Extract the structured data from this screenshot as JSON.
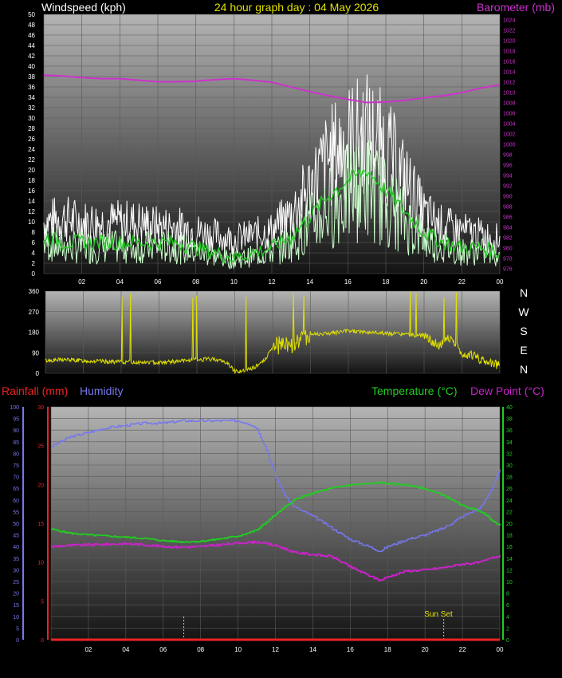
{
  "header": {
    "wind_label": "Windspeed (kph)",
    "title": "24 hour graph day : 04 May 2026",
    "baro_label": "Barometer (mb)"
  },
  "bottom_header": {
    "rain_label": "Rainfall (mm)",
    "humidity_label": "Humidity",
    "temp_label": "Temperature (°C)",
    "dew_label": "Dew Point (°C)"
  },
  "compass": [
    "N",
    "W",
    "S",
    "E",
    "N"
  ],
  "sunset_label": "Sun Set",
  "colors": {
    "wind_gust": "#ffffff",
    "wind_avg": "#22cc22",
    "wind_light": "#ccffcc",
    "barometer": "#cc33cc",
    "direction": "#e0e000",
    "humidity": "#7777ee",
    "temperature": "#22cc22",
    "dewpoint": "#cc22cc",
    "rainfall": "#ee2222",
    "marker": "#e0e000"
  },
  "chart_data": [
    {
      "type": "line",
      "title": "24 hour graph day : 04 May 2026",
      "x_ticks": [
        "02",
        "04",
        "06",
        "08",
        "10",
        "12",
        "14",
        "16",
        "18",
        "20",
        "22",
        "00"
      ],
      "x_hours": [
        0,
        2,
        4,
        6,
        8,
        10,
        12,
        14,
        16,
        18,
        20,
        22,
        24
      ],
      "ylabel_left": "Windspeed (kph)",
      "ylim_left": [
        0,
        50
      ],
      "y_ticks_left": [
        0,
        2,
        4,
        6,
        8,
        10,
        12,
        14,
        16,
        18,
        20,
        22,
        24,
        26,
        28,
        30,
        32,
        34,
        36,
        38,
        40,
        42,
        44,
        46,
        48,
        50
      ],
      "ylabel_right": "Barometer (mb)",
      "ylim_right": [
        975,
        1025
      ],
      "y_ticks_right": [
        976,
        978,
        980,
        982,
        984,
        986,
        988,
        990,
        992,
        994,
        996,
        998,
        1000,
        1002,
        1004,
        1006,
        1008,
        1010,
        1012,
        1014,
        1016,
        1018,
        1020,
        1022,
        1024
      ],
      "series": [
        {
          "name": "Windspeed (kph)",
          "key": "gust_envelope",
          "hours": [
            0,
            1,
            2,
            3,
            4,
            5,
            6,
            7,
            8,
            9,
            10,
            11,
            12,
            13,
            14,
            15,
            16,
            17,
            18,
            19,
            20,
            21,
            22,
            23,
            24
          ],
          "values": [
            12,
            13,
            12,
            12,
            12,
            12,
            11,
            11,
            10,
            9,
            8,
            9,
            10,
            14,
            20,
            27,
            31,
            33,
            29,
            22,
            14,
            11,
            10,
            9,
            8
          ]
        },
        {
          "name": "Windspeed avg",
          "key": "avg_envelope",
          "hours": [
            0,
            1,
            2,
            3,
            4,
            5,
            6,
            7,
            8,
            9,
            10,
            11,
            12,
            13,
            14,
            15,
            16,
            17,
            18,
            19,
            20,
            21,
            22,
            23,
            24
          ],
          "values": [
            7,
            6,
            6,
            6,
            6,
            6,
            6,
            6,
            5,
            4,
            3,
            4,
            5,
            7,
            11,
            15,
            18,
            20,
            16,
            12,
            8,
            6,
            5,
            5,
            4
          ]
        },
        {
          "name": "Barometer (mb)",
          "key": "barometer",
          "hours": [
            0,
            1,
            2,
            3,
            4,
            5,
            6,
            7,
            8,
            9,
            10,
            11,
            12,
            13,
            14,
            15,
            16,
            17,
            18,
            19,
            20,
            21,
            22,
            23,
            24
          ],
          "values": [
            1013.3,
            1013.1,
            1012.8,
            1012.6,
            1012.6,
            1012.3,
            1012.0,
            1012.0,
            1012.1,
            1012.4,
            1012.6,
            1012.3,
            1011.9,
            1011.0,
            1010.1,
            1009.3,
            1008.6,
            1008.0,
            1008.1,
            1008.4,
            1008.9,
            1009.3,
            1009.9,
            1010.8,
            1011.4
          ]
        }
      ]
    },
    {
      "type": "line",
      "title": "",
      "ylim": [
        0,
        360
      ],
      "y_ticks": [
        0,
        90,
        180,
        270,
        360
      ],
      "compass_labels": [
        "N",
        "W",
        "S",
        "E",
        "N"
      ],
      "series": [
        {
          "name": "Wind direction",
          "key": "direction",
          "hours": [
            0,
            1,
            2,
            3,
            4,
            5,
            6,
            7,
            8,
            9,
            9.6,
            10,
            10.5,
            11,
            11.5,
            12,
            12.5,
            13,
            13.5,
            14,
            15,
            16,
            17,
            18,
            19,
            20,
            20.8,
            21.2,
            21.6,
            22,
            22.5,
            23,
            23.5,
            24
          ],
          "values": [
            55,
            60,
            55,
            52,
            50,
            48,
            48,
            52,
            60,
            62,
            45,
            10,
            10,
            25,
            50,
            110,
            130,
            120,
            150,
            170,
            175,
            185,
            180,
            175,
            170,
            165,
            120,
            160,
            140,
            80,
            80,
            60,
            50,
            30
          ]
        }
      ]
    },
    {
      "type": "line",
      "title": "",
      "ylabel_left": "Rainfall (mm)",
      "ylim_rain": [
        0,
        30
      ],
      "y_ticks_rain": [
        0,
        5,
        10,
        15,
        20,
        25,
        30
      ],
      "ylabel_left_outer": "Humidity",
      "ylim_humidity": [
        0,
        100
      ],
      "y_ticks_humidity": [
        0,
        5,
        10,
        15,
        20,
        25,
        30,
        35,
        40,
        45,
        50,
        55,
        60,
        65,
        70,
        75,
        80,
        85,
        90,
        95,
        100
      ],
      "ylabel_right": "Temperature (°C) / Dew Point (°C)",
      "ylim_temp": [
        0,
        40
      ],
      "y_ticks_temp": [
        0,
        2,
        4,
        6,
        8,
        10,
        12,
        14,
        16,
        18,
        20,
        22,
        24,
        26,
        28,
        30,
        32,
        34,
        36,
        38,
        40
      ],
      "sunset_hour": 21.0,
      "sunrise_hour": 7.1,
      "series": [
        {
          "name": "Humidity",
          "key": "humidity",
          "hours": [
            0,
            1,
            2,
            3,
            4,
            5,
            6,
            7,
            8,
            9,
            10,
            10.5,
            11,
            11.5,
            12,
            12.5,
            13,
            14,
            15,
            16,
            17,
            17.6,
            18,
            19,
            20,
            21,
            22,
            23,
            23.5,
            24
          ],
          "values": [
            83,
            87,
            89,
            91,
            92,
            93,
            93,
            94,
            94,
            94,
            94,
            93,
            91,
            82,
            70,
            62,
            57,
            53,
            48,
            43,
            40,
            38,
            40,
            43,
            45,
            48,
            53,
            57,
            64,
            73
          ]
        },
        {
          "name": "Temperature (°C)",
          "key": "temperature",
          "hours": [
            0,
            1,
            2,
            3,
            4,
            5,
            6,
            7,
            8,
            9,
            10,
            11,
            12,
            13,
            14,
            15,
            16,
            17,
            17.6,
            18,
            19,
            20,
            21,
            22,
            23,
            24
          ],
          "values": [
            19.0,
            18.3,
            18.0,
            17.8,
            17.6,
            17.4,
            17.0,
            16.8,
            16.9,
            17.3,
            17.8,
            18.8,
            21.5,
            24.0,
            25.2,
            26.0,
            26.6,
            26.8,
            27.0,
            26.8,
            26.6,
            25.9,
            24.8,
            23.0,
            22.0,
            19.5
          ]
        },
        {
          "name": "Dew Point (°C)",
          "key": "dewpoint",
          "hours": [
            0,
            1,
            2,
            3,
            4,
            5,
            6,
            7,
            8,
            9,
            10,
            11,
            12,
            13,
            14,
            15,
            16,
            17,
            17.6,
            18,
            19,
            20,
            21,
            22,
            23,
            23.5,
            24
          ],
          "values": [
            16.0,
            16.2,
            16.3,
            16.4,
            16.5,
            16.3,
            16.0,
            15.9,
            16.0,
            16.3,
            16.6,
            16.8,
            16.2,
            15.0,
            14.6,
            14.3,
            12.5,
            11.0,
            10.2,
            10.8,
            11.8,
            12.0,
            12.4,
            13.0,
            13.3,
            14.0,
            14.4
          ]
        },
        {
          "name": "Rainfall (mm)",
          "key": "rainfall",
          "hours": [
            0,
            24
          ],
          "values": [
            0,
            0
          ]
        }
      ]
    }
  ]
}
